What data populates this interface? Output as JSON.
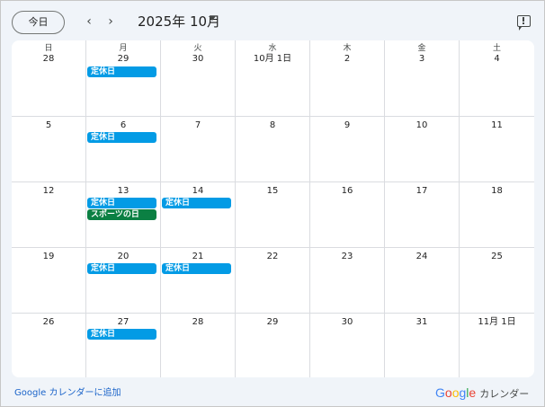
{
  "toolbar": {
    "today_label": "今日",
    "prev_icon": "‹",
    "next_icon": "›",
    "month_title": "2025年 10月"
  },
  "weekdays": [
    "日",
    "月",
    "火",
    "水",
    "木",
    "金",
    "土"
  ],
  "weeks": [
    [
      {
        "day": "28",
        "events": []
      },
      {
        "day": "29",
        "events": [
          {
            "title": "定休日",
            "color": "#039be5"
          }
        ]
      },
      {
        "day": "30",
        "events": []
      },
      {
        "day": "10月 1日",
        "events": []
      },
      {
        "day": "2",
        "events": []
      },
      {
        "day": "3",
        "events": []
      },
      {
        "day": "4",
        "events": []
      }
    ],
    [
      {
        "day": "5",
        "events": []
      },
      {
        "day": "6",
        "events": [
          {
            "title": "定休日",
            "color": "#039be5"
          }
        ]
      },
      {
        "day": "7",
        "events": []
      },
      {
        "day": "8",
        "events": []
      },
      {
        "day": "9",
        "events": []
      },
      {
        "day": "10",
        "events": []
      },
      {
        "day": "11",
        "events": []
      }
    ],
    [
      {
        "day": "12",
        "events": []
      },
      {
        "day": "13",
        "events": [
          {
            "title": "定休日",
            "color": "#039be5"
          },
          {
            "title": "スポーツの日",
            "color": "#0b8043"
          }
        ]
      },
      {
        "day": "14",
        "events": [
          {
            "title": "定休日",
            "color": "#039be5"
          }
        ]
      },
      {
        "day": "15",
        "events": []
      },
      {
        "day": "16",
        "events": []
      },
      {
        "day": "17",
        "events": []
      },
      {
        "day": "18",
        "events": []
      }
    ],
    [
      {
        "day": "19",
        "events": []
      },
      {
        "day": "20",
        "events": [
          {
            "title": "定休日",
            "color": "#039be5"
          }
        ]
      },
      {
        "day": "21",
        "events": [
          {
            "title": "定休日",
            "color": "#039be5"
          }
        ]
      },
      {
        "day": "22",
        "events": []
      },
      {
        "day": "23",
        "events": []
      },
      {
        "day": "24",
        "events": []
      },
      {
        "day": "25",
        "events": []
      }
    ],
    [
      {
        "day": "26",
        "events": []
      },
      {
        "day": "27",
        "events": [
          {
            "title": "定休日",
            "color": "#039be5"
          }
        ]
      },
      {
        "day": "28",
        "events": []
      },
      {
        "day": "29",
        "events": []
      },
      {
        "day": "30",
        "events": []
      },
      {
        "day": "31",
        "events": []
      },
      {
        "day": "11月 1日",
        "events": []
      }
    ]
  ],
  "footer": {
    "add_link": "Google カレンダーに追加",
    "brand_letters": [
      {
        "ch": "G",
        "color": "#4285f4"
      },
      {
        "ch": "o",
        "color": "#ea4335"
      },
      {
        "ch": "o",
        "color": "#fbbc04"
      },
      {
        "ch": "g",
        "color": "#4285f4"
      },
      {
        "ch": "l",
        "color": "#34a853"
      },
      {
        "ch": "e",
        "color": "#ea4335"
      }
    ],
    "brand_suffix": "カレンダー"
  }
}
